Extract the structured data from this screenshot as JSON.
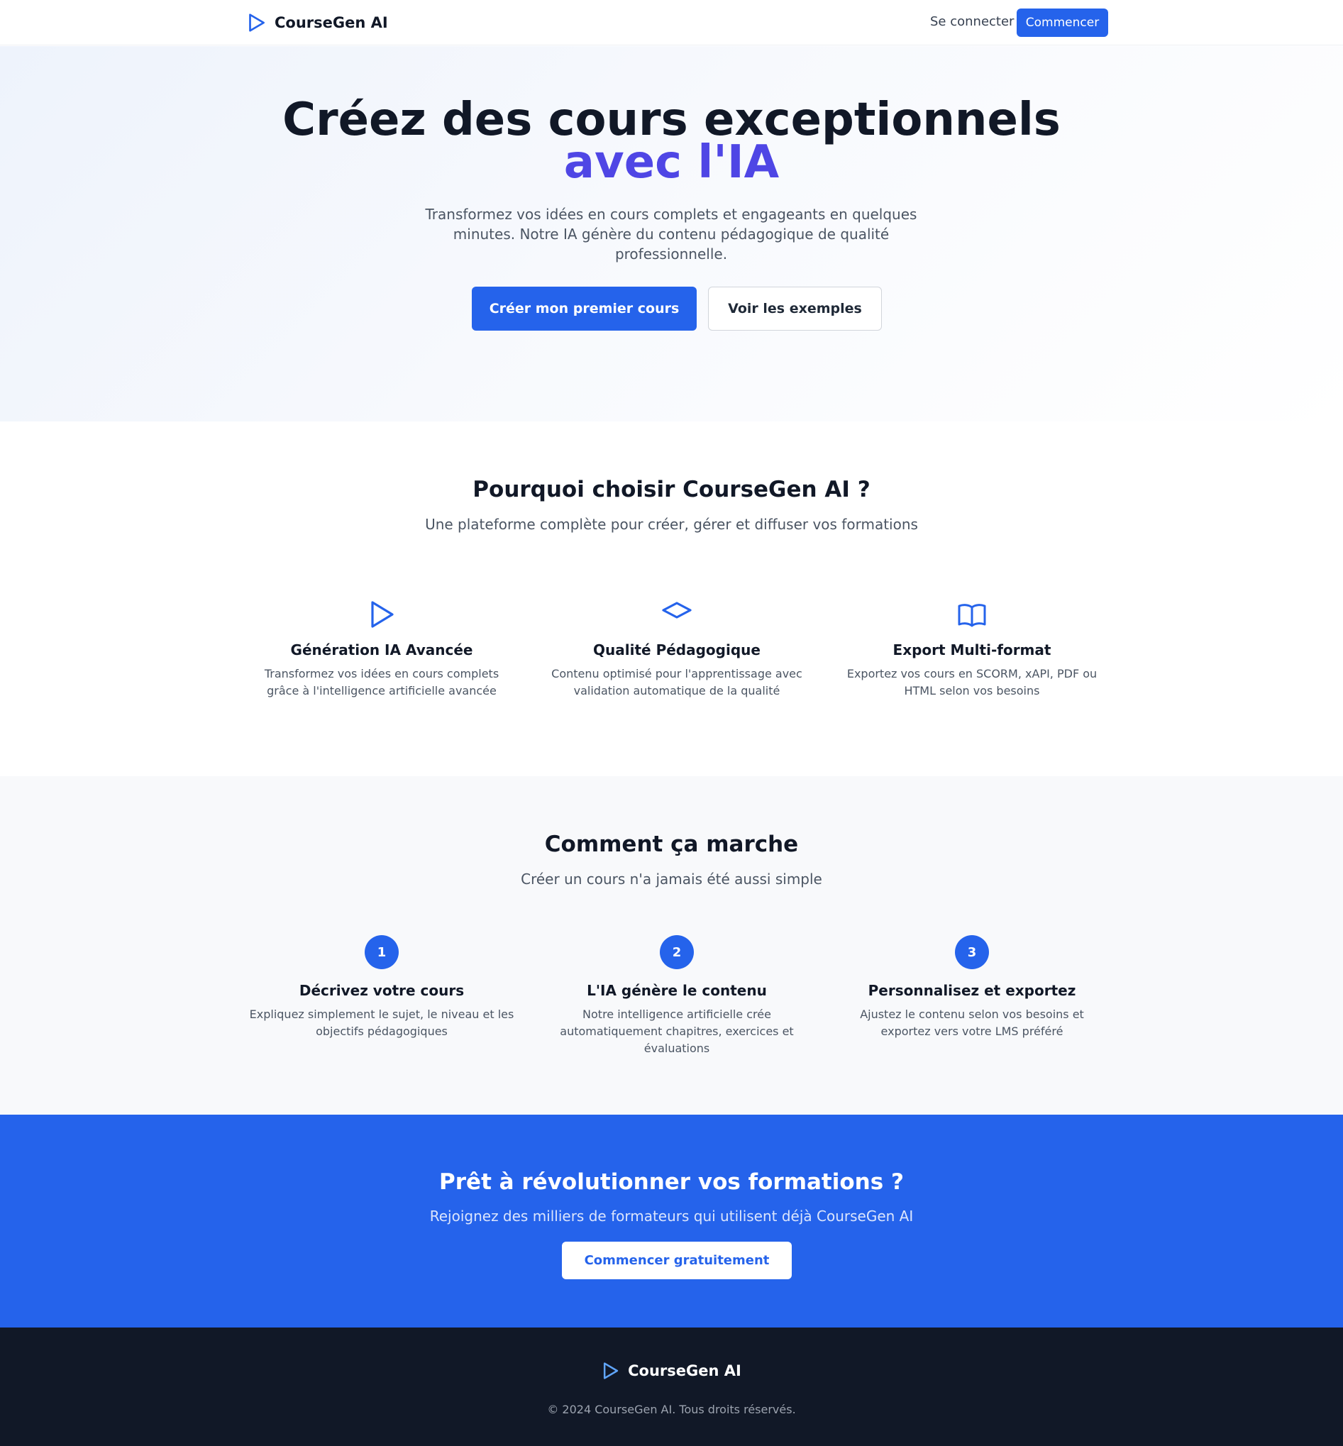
{
  "header": {
    "brand": "CourseGen AI",
    "login_label": "Se connecter",
    "cta_label": "Commencer"
  },
  "hero": {
    "title_line1": "Créez des cours exceptionnels",
    "title_line2": "avec l'IA",
    "subtitle": "Transformez vos idées en cours complets et engageants en quelques minutes. Notre IA génère du contenu pédagogique de qualité professionnelle.",
    "primary_button": "Créer mon premier cours",
    "secondary_button": "Voir les exemples"
  },
  "features": {
    "title": "Pourquoi choisir CourseGen AI ?",
    "subtitle": "Une plateforme complète pour créer, gérer et diffuser vos formations",
    "items": [
      {
        "icon": "play-icon",
        "title": "Génération IA Avancée",
        "description": "Transformez vos idées en cours complets grâce à l'intelligence artificielle avancée"
      },
      {
        "icon": "diamond-icon",
        "title": "Qualité Pédagogique",
        "description": "Contenu optimisé pour l'apprentissage avec validation automatique de la qualité"
      },
      {
        "icon": "book-icon",
        "title": "Export Multi-format",
        "description": "Exportez vos cours en SCORM, xAPI, PDF ou HTML selon vos besoins"
      }
    ]
  },
  "steps": {
    "title": "Comment ça marche",
    "subtitle": "Créer un cours n'a jamais été aussi simple",
    "items": [
      {
        "number": "1",
        "title": "Décrivez votre cours",
        "description": "Expliquez simplement le sujet, le niveau et les objectifs pédagogiques"
      },
      {
        "number": "2",
        "title": "L'IA génère le contenu",
        "description": "Notre intelligence artificielle crée automatiquement chapitres, exercices et évaluations"
      },
      {
        "number": "3",
        "title": "Personnalisez et exportez",
        "description": "Ajustez le contenu selon vos besoins et exportez vers votre LMS préféré"
      }
    ]
  },
  "cta": {
    "title": "Prêt à révolutionner vos formations ?",
    "subtitle": "Rejoignez des milliers de formateurs qui utilisent déjà CourseGen AI",
    "button": "Commencer gratuitement"
  },
  "footer": {
    "brand": "CourseGen AI",
    "copyright": "© 2024 CourseGen AI. Tous droits réservés."
  },
  "colors": {
    "primary": "#2563eb",
    "accent": "#4f46e5",
    "dark": "#111827",
    "footer_logo": "#60a5fa"
  }
}
